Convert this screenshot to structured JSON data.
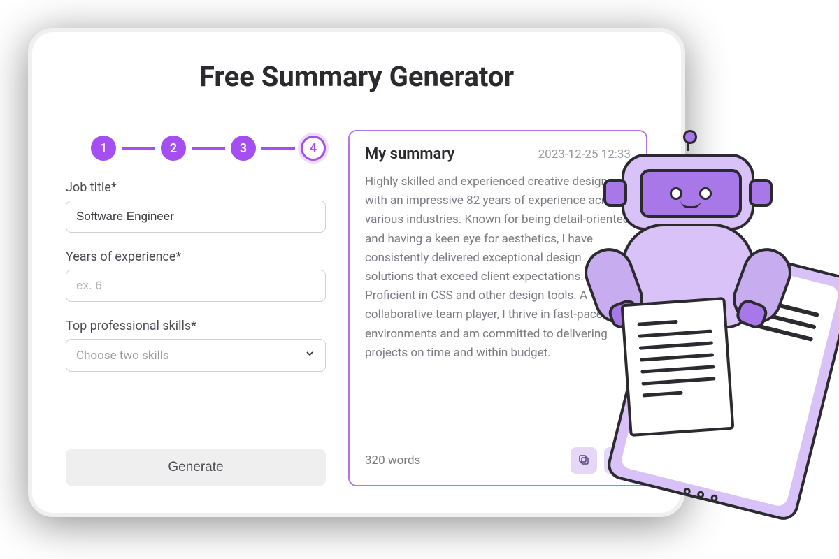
{
  "title": "Free Summary Generator",
  "steps": [
    "1",
    "2",
    "3",
    "4"
  ],
  "current_step": 4,
  "form": {
    "job_title_label": "Job title*",
    "job_title_value": "Software Engineer",
    "experience_label": "Years of experience*",
    "experience_placeholder": "ex. 6",
    "experience_value": "",
    "skills_label": "Top professional skills*",
    "skills_placeholder": "Choose two skills",
    "generate_label": "Generate"
  },
  "summary": {
    "heading": "My summary",
    "timestamp": "2023-12-25 12:33",
    "body": "Highly skilled and experienced creative designer with an impressive 82 years of experience across various industries. Known for being detail-oriented and having a keen eye for aesthetics, I have consistently delivered exceptional design solutions that exceed client expectations. Proficient in CSS and other design tools. A collaborative team player, I thrive in fast-paced environments and am committed to delivering projects on time and within budget.",
    "word_count": "320 words"
  },
  "colors": {
    "accent": "#a54ef1",
    "accent_light": "#d9c2f7"
  }
}
